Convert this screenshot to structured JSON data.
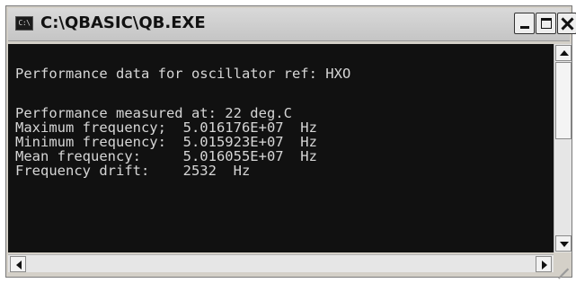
{
  "window": {
    "title": "C:\\QBASIC\\QB.EXE",
    "icon_text": "C:\\",
    "controls": [
      "minimize",
      "maximize",
      "close"
    ]
  },
  "console": {
    "lines": [
      "",
      "Performance data for oscillator ref: HXO",
      "",
      "Performance measured at: 22 deg.C",
      "Maximum frequency;  5.016176E+07  Hz",
      "Minimum frequency:  5.015923E+07  Hz",
      "Mean frequency:     5.016055E+07  Hz",
      "Frequency drift:    2532  Hz"
    ]
  },
  "colors": {
    "console_bg": "#111111",
    "console_text": "#d6d6d6",
    "chrome": "#d4d0c8"
  },
  "icons": {
    "minimize": "minimize-icon",
    "maximize": "maximize-icon",
    "close": "close-icon",
    "scroll_up": "arrow-up-icon",
    "scroll_down": "arrow-down-icon",
    "scroll_left": "arrow-left-icon",
    "scroll_right": "arrow-right-icon"
  }
}
